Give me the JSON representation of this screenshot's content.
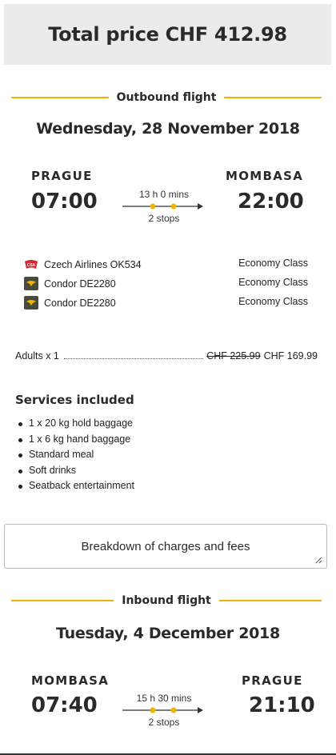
{
  "total": {
    "label": "Total price CHF 412.98"
  },
  "outbound": {
    "section_label": "Outbound flight",
    "date": "Wednesday, 28 November 2018",
    "from_city": "PRAGUE",
    "to_city": "MOMBASA",
    "depart_time": "07:00",
    "arrive_time": "22:00",
    "duration": "13 h 0 mins",
    "stops": "2 stops",
    "segments": [
      {
        "carrier": "Czech Airlines OK534",
        "cabin": "Economy Class",
        "logo": "czech-airlines-logo"
      },
      {
        "carrier": "Condor DE2280",
        "cabin": "Economy Class",
        "logo": "condor-logo"
      },
      {
        "carrier": "Condor DE2280",
        "cabin": "Economy Class",
        "logo": "condor-logo"
      }
    ]
  },
  "pricing": {
    "passengers": "Adults x 1",
    "old_price": "CHF 225.99",
    "new_price": "CHF 169.99"
  },
  "services": {
    "title": "Services included",
    "items": [
      "1 x 20 kg hold baggage",
      "1 x 6 kg hand baggage",
      "Standard meal",
      "Soft drinks",
      "Seatback entertainment"
    ]
  },
  "breakdown": {
    "label": "Breakdown of charges and fees"
  },
  "inbound": {
    "section_label": "Inbound flight",
    "date": "Tuesday, 4 December 2018",
    "from_city": "MOMBASA",
    "to_city": "PRAGUE",
    "depart_time": "07:40",
    "arrive_time": "21:10",
    "duration": "15 h 30 mins",
    "stops": "2 stops"
  },
  "colors": {
    "accent": "#f0b400",
    "czech_red": "#d7282f",
    "condor_bg": "#4a4a3c"
  }
}
